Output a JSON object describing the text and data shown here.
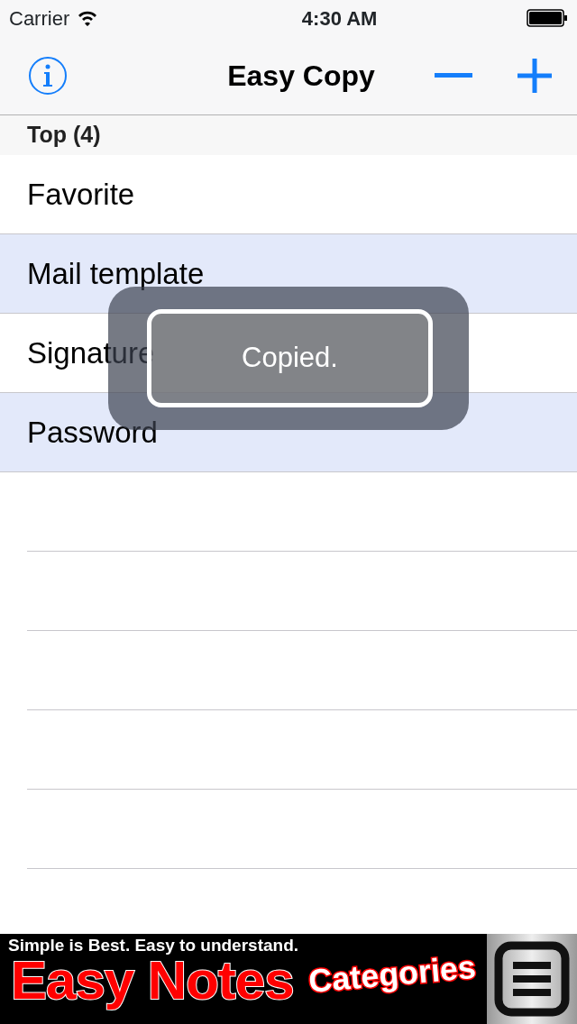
{
  "status_bar": {
    "carrier": "Carrier",
    "time": "4:30 AM"
  },
  "nav": {
    "title": "Easy Copy"
  },
  "section": {
    "title": "Top (4)"
  },
  "rows": [
    {
      "label": "Favorite"
    },
    {
      "label": "Mail template"
    },
    {
      "label": "Signature"
    },
    {
      "label": "Password"
    }
  ],
  "toast": {
    "message": "Copied."
  },
  "ad": {
    "tagline": "Simple is Best. Easy to understand.",
    "headline": "Easy Notes",
    "badge": "Categories"
  }
}
